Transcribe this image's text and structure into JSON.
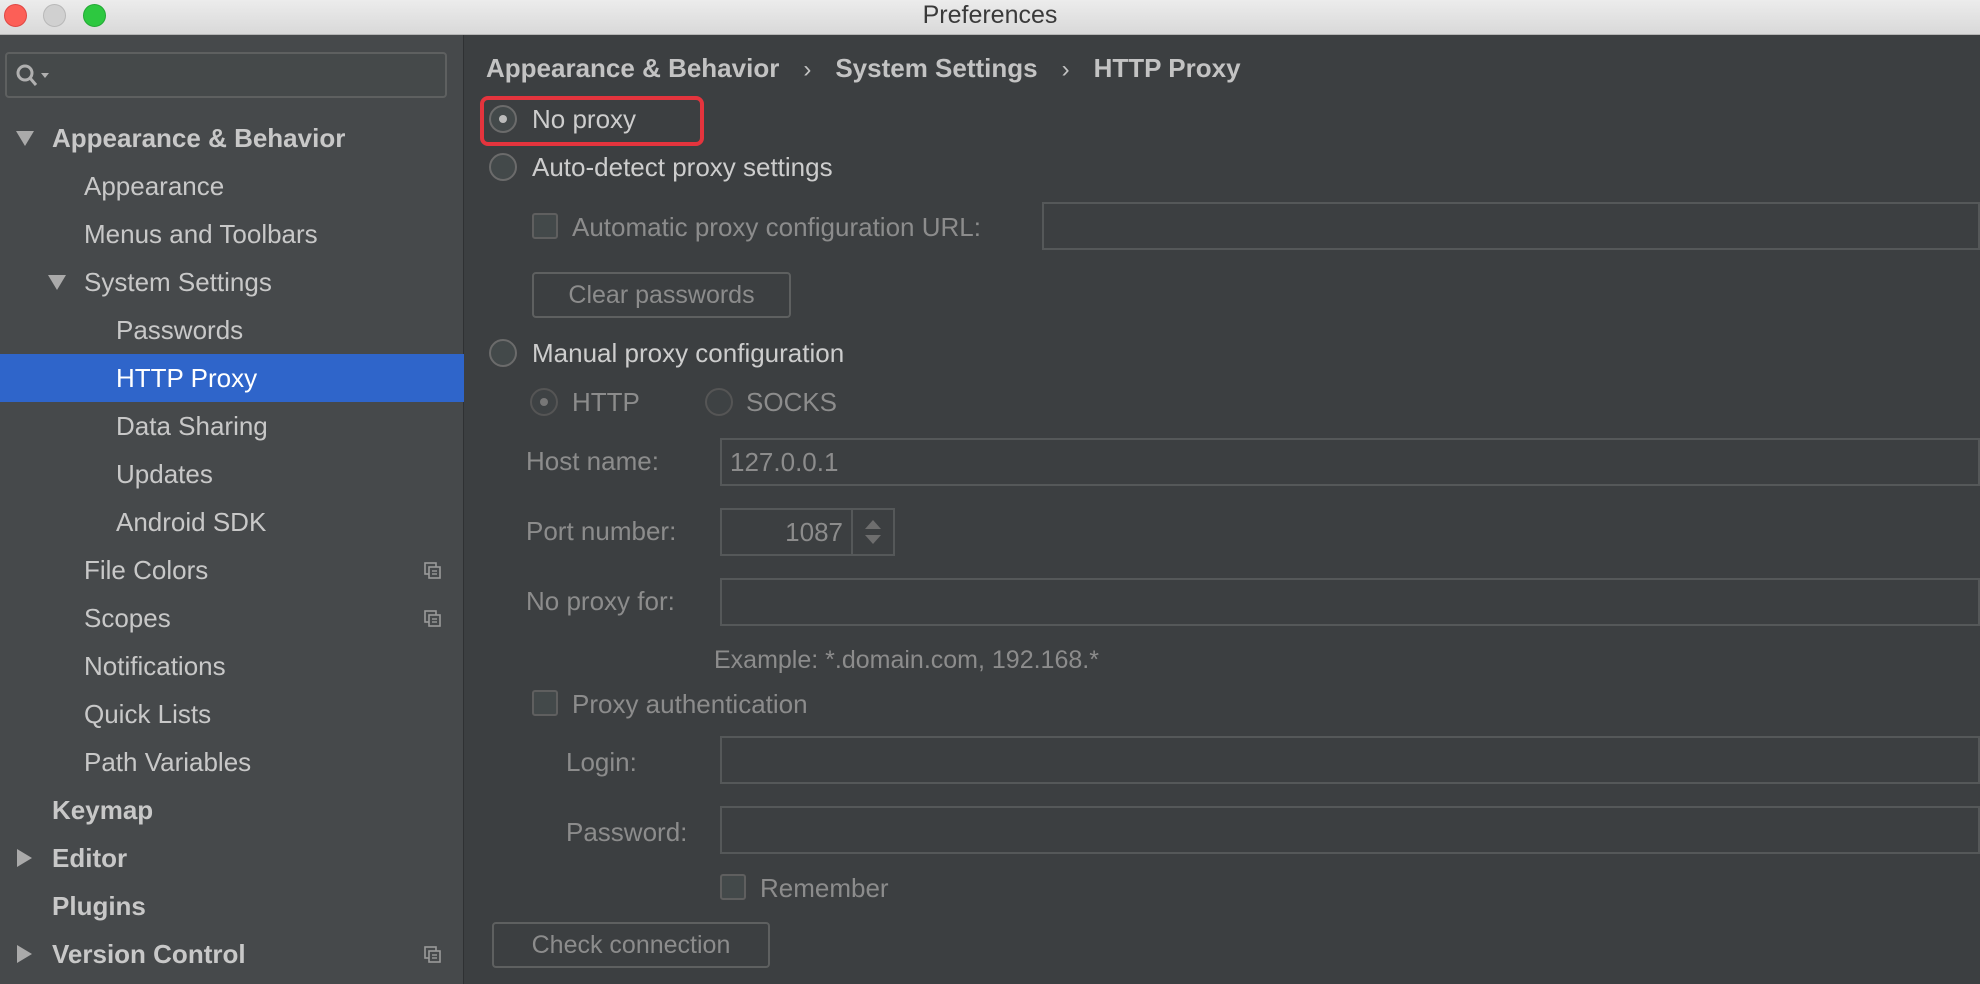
{
  "window": {
    "title": "Preferences"
  },
  "sidebar": {
    "items": [
      {
        "label": "Appearance & Behavior"
      },
      {
        "label": "Appearance"
      },
      {
        "label": "Menus and Toolbars"
      },
      {
        "label": "System Settings"
      },
      {
        "label": "Passwords"
      },
      {
        "label": "HTTP Proxy"
      },
      {
        "label": "Data Sharing"
      },
      {
        "label": "Updates"
      },
      {
        "label": "Android SDK"
      },
      {
        "label": "File Colors"
      },
      {
        "label": "Scopes"
      },
      {
        "label": "Notifications"
      },
      {
        "label": "Quick Lists"
      },
      {
        "label": "Path Variables"
      },
      {
        "label": "Keymap"
      },
      {
        "label": "Editor"
      },
      {
        "label": "Plugins"
      },
      {
        "label": "Version Control"
      }
    ]
  },
  "breadcrumb": [
    "Appearance & Behavior",
    "System Settings",
    "HTTP Proxy"
  ],
  "breadcrumb_separator": "›",
  "proxy": {
    "no_proxy_label": "No proxy",
    "auto_detect_label": "Auto-detect proxy settings",
    "auto_config_url_label": "Automatic proxy configuration URL:",
    "auto_config_url_value": "",
    "clear_passwords_label": "Clear passwords",
    "manual_label": "Manual proxy configuration",
    "http_label": "HTTP",
    "socks_label": "SOCKS",
    "host_label": "Host name:",
    "host_value": "127.0.0.1",
    "port_label": "Port number:",
    "port_value": "1087",
    "no_proxy_for_label": "No proxy for:",
    "no_proxy_for_value": "",
    "example_text": "Example: *.domain.com, 192.168.*",
    "auth_label": "Proxy authentication",
    "login_label": "Login:",
    "login_value": "",
    "password_label": "Password:",
    "password_value": "",
    "remember_label": "Remember",
    "check_connection_label": "Check connection",
    "selected_mode": "No proxy"
  },
  "colors": {
    "selection": "#2f65ca",
    "highlight_border": "#e4343d",
    "sidebar_bg": "#46494b",
    "panel_bg": "#3c3f41"
  }
}
